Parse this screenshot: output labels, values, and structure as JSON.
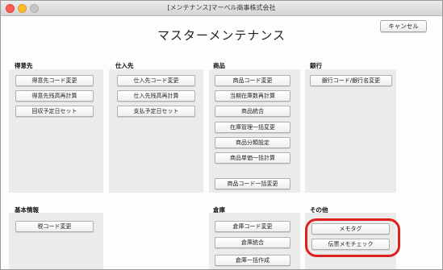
{
  "window": {
    "title": "[メンテナンス]マーベル商事株式会社"
  },
  "page": {
    "title": "マスターメンテナンス",
    "cancel_label": "キャンセル"
  },
  "sections": {
    "customer": {
      "title": "得意先",
      "buttons": [
        "得意先コード変更",
        "得意先残高再計算",
        "回収予定日セット"
      ]
    },
    "supplier": {
      "title": "仕入先",
      "buttons": [
        "仕入先コード変更",
        "仕入先残高再計算",
        "支払予定日セット"
      ]
    },
    "product": {
      "title": "商品",
      "buttons": [
        "商品コード変更",
        "当期在庫数再計算",
        "商品統合",
        "在庫管理一括変更",
        "商品分類設定",
        "商品単価一括計算",
        "商品コード一括変更"
      ]
    },
    "bank": {
      "title": "銀行",
      "buttons": [
        "銀行コード/銀行名変更"
      ]
    },
    "basic": {
      "title": "基本情報",
      "buttons": [
        "税コード変更"
      ]
    },
    "warehouse": {
      "title": "倉庫",
      "buttons": [
        "倉庫コード変更",
        "倉庫統合",
        "倉庫一括作成"
      ]
    },
    "other": {
      "title": "その他",
      "buttons": [
        "メモタグ",
        "伝票メモチェック"
      ]
    }
  },
  "colors": {
    "highlight": "#e0201e",
    "panel": "#ebebeb"
  }
}
